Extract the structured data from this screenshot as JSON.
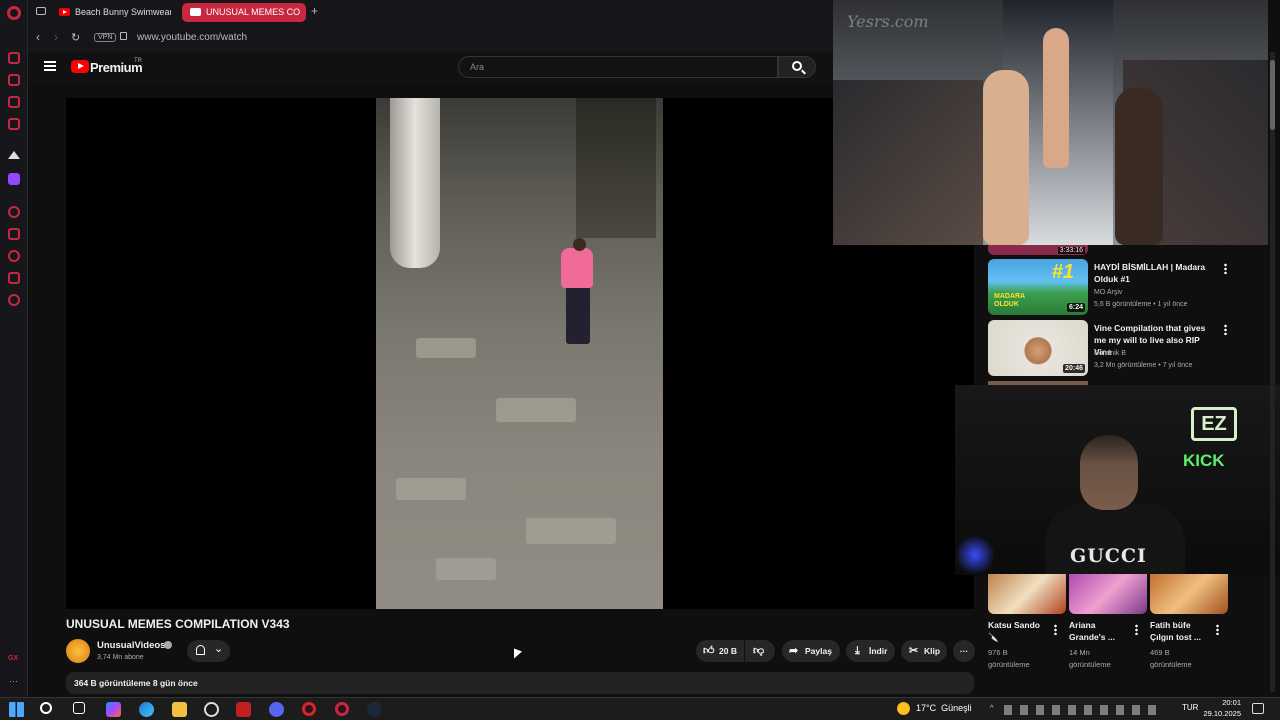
{
  "browser": {
    "tabs": [
      {
        "label": "Beach Bunny Swimwear B",
        "active": false
      },
      {
        "label": "UNUSUAL MEMES CO",
        "active": true
      }
    ],
    "new_tab_label": "+",
    "vpn_label": "VPN",
    "url": "www.youtube.com/watch"
  },
  "youtube": {
    "logo_text": "Premium",
    "logo_badge": "TR",
    "search_placeholder": "Ara"
  },
  "video": {
    "title": "UNUSUAL MEMES COMPILATION V343",
    "channel": "UnusualVideos",
    "subscribers": "3,74 Mn abone",
    "likes": "20 B",
    "share_label": "Paylaş",
    "download_label": "İndir",
    "clip_label": "Klip",
    "more_label": "···",
    "views_date": "364 B görüntüleme  8 gün önce"
  },
  "recommendations": [
    {
      "title": "HAYDİ BİSMİLLAH | Madara Olduk #1",
      "channel": "MO Arşiv",
      "meta": "5,6 B görüntüleme • 1 yıl önce",
      "duration": "6:24",
      "thumb_text": "#1",
      "thumb_caption": "MADARA OLDUK"
    },
    {
      "title": "Vine Compilation that gives me my will to live also RIP Vine",
      "channel": "Dominik B",
      "meta": "3,2 Mn görüntüleme • 7 yıl önce",
      "duration": "20:46"
    }
  ],
  "partial_duration": "3:33:16",
  "shorts": [
    {
      "title": "Katsu Sando 🔪",
      "meta": "976 B görüntüleme"
    },
    {
      "title": "Ariana Grande's ...",
      "meta": "14 Mn görüntüleme"
    },
    {
      "title": "Fatih büfe Çılgın tost ...",
      "meta": "469 B görüntüleme"
    }
  ],
  "overlays": {
    "runway_watermark": "Yesrs.com",
    "webcam_shirt": "GUCCI",
    "ez_logo": "EZ",
    "kick_logo": "KICK"
  },
  "taskbar": {
    "weather": "17°C  Güneşli",
    "lang": "TUR",
    "time": "20:01",
    "date": "29.10.2025"
  },
  "colors": {
    "accent": "#c8283f",
    "youtube_red": "#ff0000",
    "kick_green": "#5cf06a"
  }
}
